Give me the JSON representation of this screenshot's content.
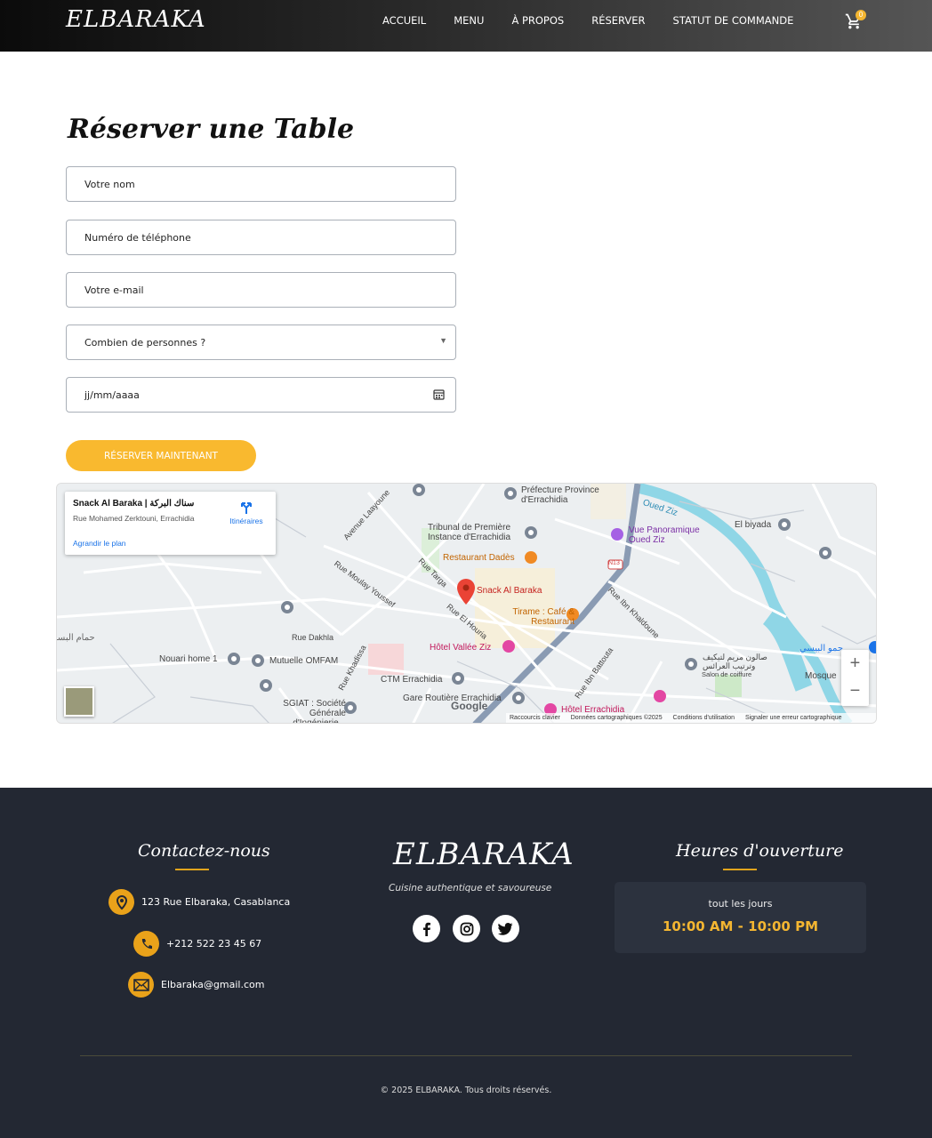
{
  "header": {
    "logo": "ELBARAKA",
    "nav": [
      "ACCUEIL",
      "MENU",
      "À PROPOS",
      "RÉSERVER",
      "STATUT DE COMMANDE"
    ],
    "cart_count": "0",
    "cart_icon": "cart-icon"
  },
  "form": {
    "title": "Réserver une Table",
    "name_placeholder": "Votre nom",
    "phone_placeholder": "Numéro de téléphone",
    "email_placeholder": "Votre e-mail",
    "guests_selected": "Combien de personnes ?",
    "date_placeholder": "jj/mm/aaaa",
    "submit_label": "RÉSERVER MAINTENANT"
  },
  "map": {
    "place_name": "Snack Al Baraka | سناك البركة",
    "place_address": "Rue Mohamed Zerktouni, Errachidia",
    "enlarge_label": "Agrandir le plan",
    "directions_label": "Itinéraires",
    "labels": {
      "prefecture": "Préfecture Province d'Errachidia",
      "tribunal": "Tribunal de Première Instance d'Errachidia",
      "dades": "Restaurant Dadès",
      "snack": "Snack Al Baraka",
      "tirame": "Tirame : Café & Restaurant",
      "vallee": "Hôtel Vallée Ziz",
      "ctm": "CTM Errachidia",
      "gare": "Gare Routière Errachidia",
      "hotel_errachidia": "Hôtel Errachidia",
      "nouari": "Nouari home 1",
      "mutuelle": "Mutuelle OMFAM",
      "sgiat": "SGIAT : Société Générale d'Ingénierie...",
      "vue": "Vue Panoramique Oued Ziz",
      "oued_ziz": "Oued Ziz",
      "el_biyada": "El biyada",
      "mosque": "Mosque",
      "salon": "Salon de coiffure",
      "hammam": "حمام البسـ",
      "rue_dakhla": "Rue Dakhla",
      "av_laayoune": "Avenue Laayoune",
      "rue_moulay": "Rue Moulay Youssef",
      "rue_targa": "Rue Targa",
      "rue_houria": "Rue El Houria",
      "rue_ibn_khaldoune": "Rue Ibn Khaldoune",
      "rue_ibn_battouta": "Rue Ibn Battouta",
      "rue_khadissa": "Rue Khadissa",
      "n13": "N13",
      "arabic_salon": "صالون مريم لتيكيف وترتيب العرائس",
      "arabic_right": "ـ حمو البيسي"
    },
    "attribution": [
      "Raccourcis clavier",
      "Données cartographiques ©2025",
      "Conditions d'utilisation",
      "Signaler une erreur cartographique"
    ],
    "google": "Google",
    "zoom_in": "+",
    "zoom_out": "−"
  },
  "footer": {
    "contact_title": "Contactez-nous",
    "address": "123 Rue Elbaraka, Casablanca",
    "phone": "+212 522 23 45 67",
    "email": "Elbaraka@gmail.com",
    "brand": "ELBARAKA",
    "tagline": "Cuisine authentique et savoureuse",
    "hours_title": "Heures d'ouverture",
    "hours_days": "tout les jours",
    "hours_time": "10:00 AM - 10:00 PM",
    "copyright": "© 2025 ELBARAKA. Tous droits réservés.",
    "colors": {
      "accent": "#f4b631",
      "background": "#232833"
    }
  }
}
